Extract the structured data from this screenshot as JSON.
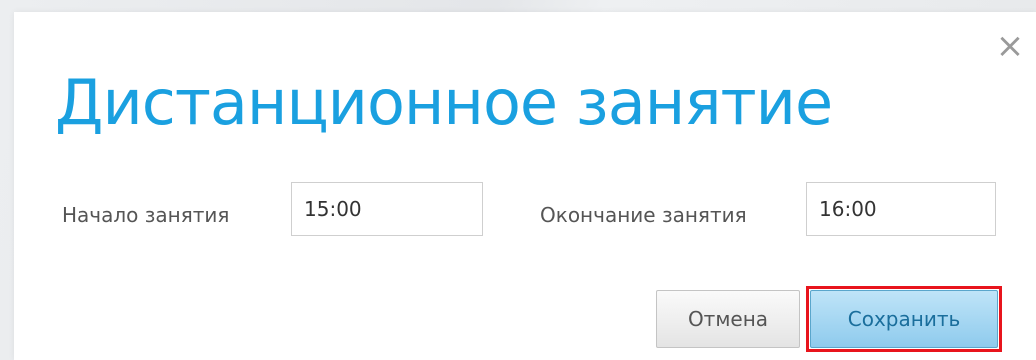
{
  "dialog": {
    "title": "Дистанционное занятие",
    "close_glyph": "×",
    "close_icon": "close-icon",
    "start": {
      "label": "Начало занятия",
      "value": "15:00"
    },
    "end": {
      "label": "Окончание занятия",
      "value": "16:00"
    },
    "buttons": {
      "cancel": "Отмена",
      "save": "Сохранить"
    }
  },
  "colors": {
    "title": "#1aa0e0",
    "highlight_outline": "#e8141c",
    "save_button": "#a9d9f3"
  }
}
